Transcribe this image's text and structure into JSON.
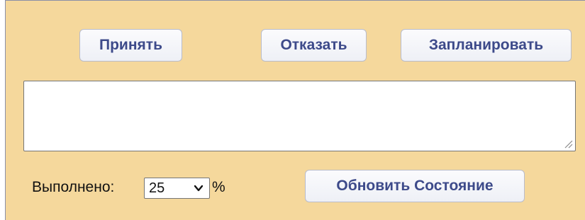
{
  "actions": {
    "accept_label": "Принять",
    "decline_label": "Отказать",
    "plan_label": "Запланировать"
  },
  "comment": {
    "value": ""
  },
  "progress": {
    "label": "Выполнено:",
    "selected": "25",
    "suffix": "%"
  },
  "update": {
    "label": "Обновить Состояние"
  },
  "colors": {
    "panel_background": "#f5d89c",
    "button_text": "#3d4a8a"
  }
}
